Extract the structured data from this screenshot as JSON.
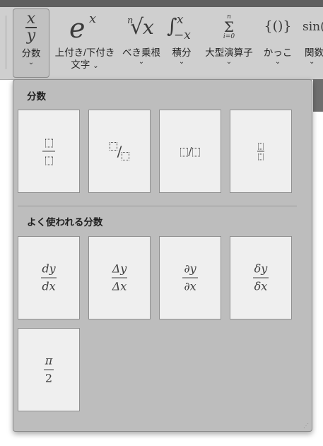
{
  "ribbon": {
    "buttons": [
      {
        "name": "fraction",
        "icon_top": "x",
        "icon_bottom": "y",
        "label1": "分数",
        "label2": ""
      },
      {
        "name": "script",
        "icon": "e",
        "icon_sup": "x",
        "label1": "上付き/下付き",
        "label2": "文字"
      },
      {
        "name": "radical",
        "icon_idx": "n",
        "icon_sym": "√",
        "icon_var": "x",
        "label1": "べき乗根",
        "label2": ""
      },
      {
        "name": "integral",
        "icon_sym": "∫",
        "icon_up": "x",
        "icon_down": "−x",
        "label1": "積分",
        "label2": ""
      },
      {
        "name": "large-operator",
        "icon_up": "n",
        "icon_sym": "Σ",
        "icon_down": "i=0",
        "label1": "大型演算子",
        "label2": ""
      },
      {
        "name": "bracket",
        "icon": "{()}",
        "label1": "かっこ",
        "label2": ""
      },
      {
        "name": "function",
        "icon": "sin(",
        "label1": "関数",
        "label2": ""
      }
    ],
    "chevron": "⌄"
  },
  "dropdown": {
    "section1_title": "分数",
    "section2_title": "よく使われる分数",
    "common": [
      {
        "num": "dy",
        "den": "dx"
      },
      {
        "num": "Δy",
        "den": "Δx"
      },
      {
        "num": "∂y",
        "den": "∂x"
      },
      {
        "num": "δy",
        "den": "δx"
      },
      {
        "num": "π",
        "den": "2"
      }
    ],
    "slash": "/"
  }
}
